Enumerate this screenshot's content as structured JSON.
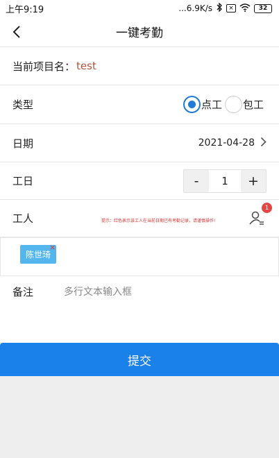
{
  "status_bar": {
    "time": "上午9:19",
    "network_speed": "...6.9K/s",
    "battery": "32",
    "icons": [
      "bluetooth-icon",
      "no-sim-icon",
      "wifi-icon",
      "battery-icon"
    ]
  },
  "header": {
    "title": "一键考勤",
    "back_icon": "chevron-left-icon"
  },
  "project": {
    "label": "当前项目名：",
    "value": "test"
  },
  "type": {
    "label": "类型",
    "options": [
      {
        "label": "点工",
        "selected": true
      },
      {
        "label": "包工",
        "selected": false
      }
    ]
  },
  "date": {
    "label": "日期",
    "value": "2021-04-28"
  },
  "workday": {
    "label": "工日",
    "minus": "-",
    "value": "1",
    "plus": "+"
  },
  "worker": {
    "label": "工人",
    "notice": "提示：红色表示该工人在当前日期已有考勤记录，请谨慎操作!",
    "badge": "1",
    "chips": [
      {
        "name": "陈世琦",
        "remove": "×"
      }
    ]
  },
  "remark": {
    "label": "备注",
    "placeholder": "多行文本输入框"
  },
  "submit": {
    "label": "提交"
  },
  "colors": {
    "primary": "#1a80ea",
    "radio_checked": "#1f7ad8",
    "project_value": "#b2553e",
    "chip": "#53b7ee",
    "badge": "#e64545",
    "notice": "#dd3333"
  }
}
